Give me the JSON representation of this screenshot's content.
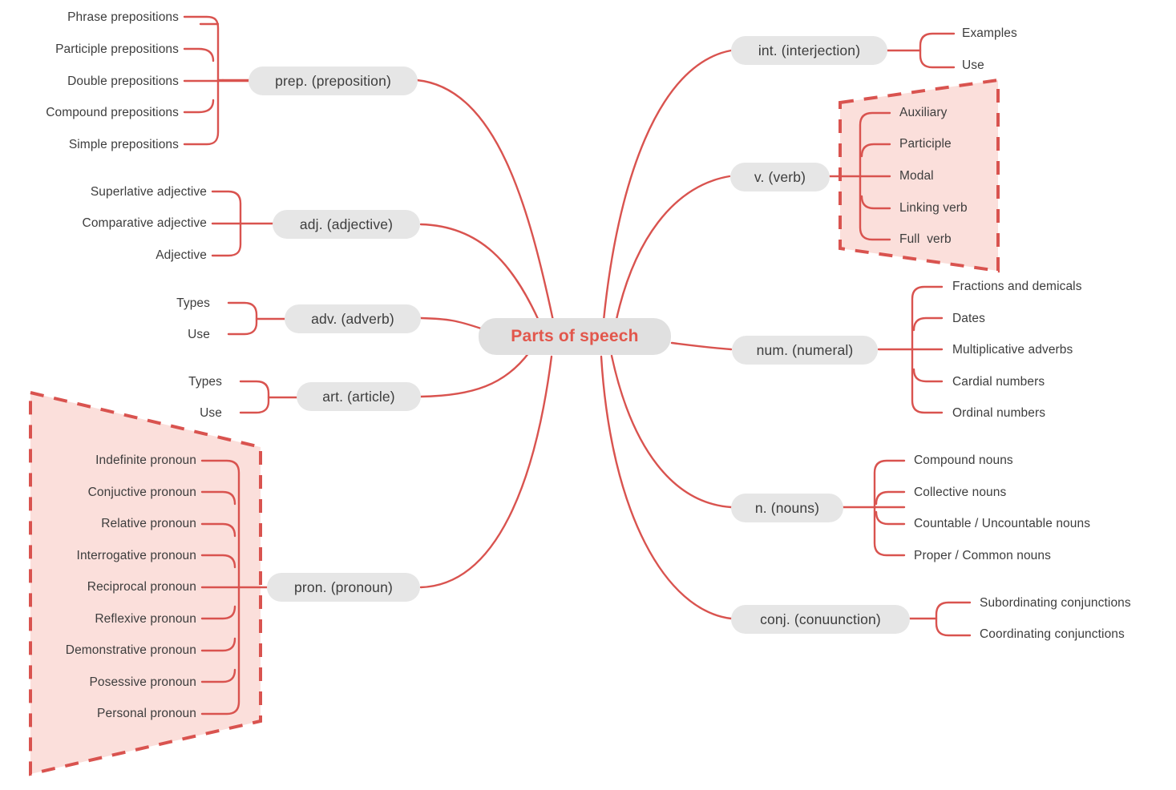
{
  "theme": {
    "accent": "#d9534f",
    "line": "#d9534f",
    "chip_bg": "#e6e6e6",
    "chip_text": "#3d3d3d",
    "central_text": "#e2574c",
    "highlight_fill": "#fbdfdb",
    "highlight_border": "#d9534f",
    "page_bg": "#ffffff"
  },
  "central": {
    "label": "Parts of speech"
  },
  "branches": {
    "preposition": {
      "label": "prep. (preposition)",
      "side": "left",
      "children": [
        "Phrase prepositions",
        "Participle prepositions",
        "Double prepositions",
        "Compound prepositions",
        "Simple prepositions"
      ]
    },
    "adjective": {
      "label": "adj. (adjective)",
      "side": "left",
      "children": [
        "Superlative adjective",
        "Comparative adjective",
        "Adjective"
      ]
    },
    "adverb": {
      "label": "adv. (adverb)",
      "side": "left",
      "children": [
        "Types",
        "Use"
      ]
    },
    "article": {
      "label": "art. (article)",
      "side": "left",
      "children": [
        "Types",
        "Use"
      ]
    },
    "pronoun": {
      "label": "pron. (pronoun)",
      "side": "left",
      "highlighted": true,
      "children": [
        "Indefinite pronoun",
        "Conjuctive pronoun",
        "Relative pronoun",
        "Interrogative pronoun",
        "Reciprocal pronoun",
        "Reflexive pronoun",
        "Demonstrative pronoun",
        "Posessive pronoun",
        "Personal pronoun"
      ]
    },
    "interjection": {
      "label": "int. (interjection)",
      "side": "right",
      "children": [
        "Examples",
        "Use"
      ]
    },
    "verb": {
      "label": "v. (verb)",
      "side": "right",
      "highlighted": true,
      "children": [
        "Auxiliary",
        "Participle",
        "Modal",
        "Linking verb",
        "Full  verb"
      ]
    },
    "numeral": {
      "label": "num. (numeral)",
      "side": "right",
      "children": [
        "Fractions and demicals",
        "Dates",
        "Multiplicative adverbs",
        "Cardial numbers",
        "Ordinal numbers"
      ]
    },
    "nouns": {
      "label": "n. (nouns)",
      "side": "right",
      "children": [
        "Compound nouns",
        "Collective nouns",
        "Countable / Uncountable nouns",
        "Proper / Common nouns"
      ]
    },
    "conjunction": {
      "label": "conj. (conuunction)",
      "side": "right",
      "children": [
        "Subordinating conjunctions",
        "Coordinating conjunctions"
      ]
    }
  }
}
